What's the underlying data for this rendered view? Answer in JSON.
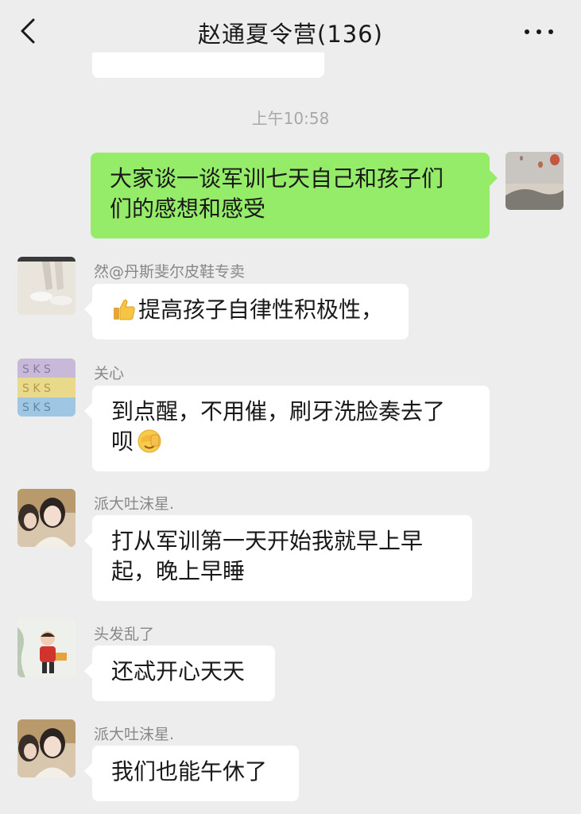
{
  "header": {
    "title": "赵通夏令营(136)",
    "back_icon": "chevron-left-icon",
    "more_icon": "more-dots-icon"
  },
  "timestamp": "上午10:58",
  "messages": [
    {
      "sender": "",
      "text": "大家谈一谈军训七天自己和孩子们们的感想和感受",
      "line1": "大家谈一谈军训七天自己和孩子们",
      "line2": "们的感想和感受",
      "outgoing": true
    },
    {
      "sender": "然@丹斯斐尔皮鞋专卖",
      "text": "提高孩子自律性积极性，",
      "emoji": "thumbs-up-icon"
    },
    {
      "sender": "关心",
      "text": "到点醒，不用催，刷牙洗脸奏去了呗",
      "line1": "到点醒，不用催，刷牙洗脸奏去了",
      "line2": "呗",
      "emoji_after": "facepalm-emoji-icon"
    },
    {
      "sender": "派大吐沫星.",
      "text": "打从军训第一天开始我就早上早起，晚上早睡",
      "line1": "打从军训第一天开始我就早上早",
      "line2": "起，晚上早睡"
    },
    {
      "sender": "头发乱了",
      "text": "还忒开心天天"
    },
    {
      "sender": "派大吐沫星.",
      "text": "我们也能午休了"
    }
  ],
  "colors": {
    "background": "#ededed",
    "outgoing_bubble": "#95ec69",
    "incoming_bubble": "#ffffff",
    "sender_name": "#888888",
    "timestamp": "#a8a8a8"
  }
}
